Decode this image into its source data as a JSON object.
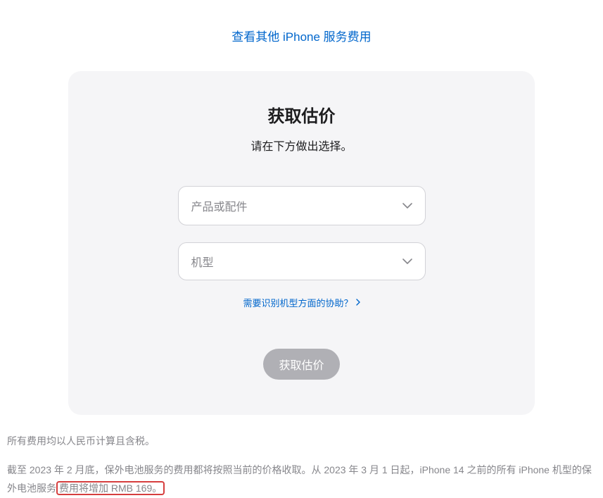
{
  "topLink": "查看其他 iPhone 服务费用",
  "card": {
    "title": "获取估价",
    "subtitle": "请在下方做出选择。",
    "select1Placeholder": "产品或配件",
    "select2Placeholder": "机型",
    "helpLink": "需要识别机型方面的协助？",
    "submitButton": "获取估价"
  },
  "footer": {
    "line1": "所有费用均以人民币计算且含税。",
    "line2Part1": "截至 2023 年 2 月底，保外电池服务的费用都将按照当前的价格收取。从 2023 年 3 月 1 日起，iPhone 14 之前的所有 iPhone 机型的保外电池服务",
    "line2Highlight": "费用将增加 RMB 169。"
  }
}
